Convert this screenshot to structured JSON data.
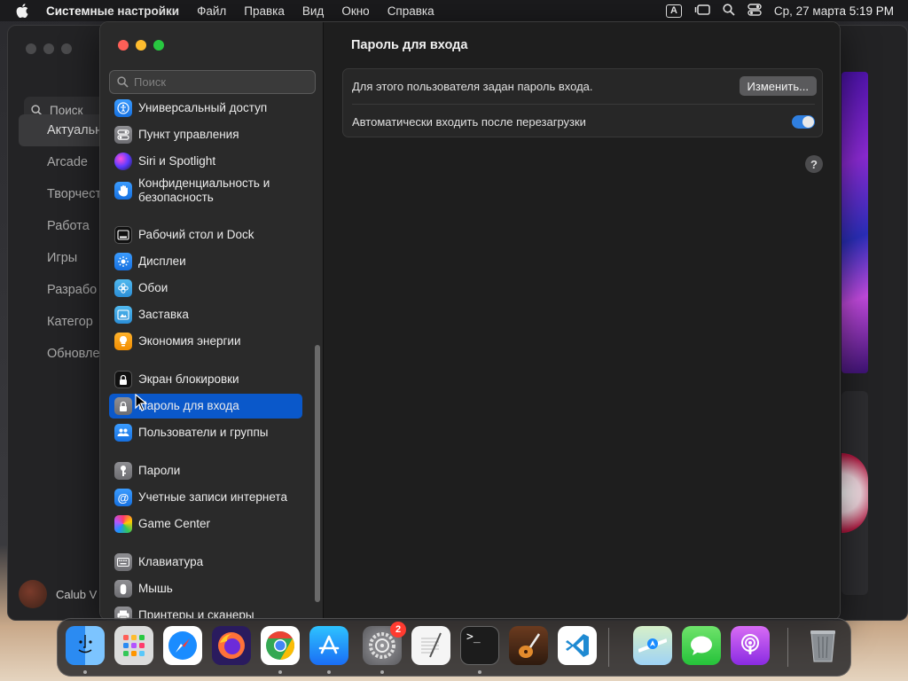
{
  "menubar": {
    "app_name": "Системные настройки",
    "items": [
      "Файл",
      "Правка",
      "Вид",
      "Окно",
      "Справка"
    ],
    "input_indicator": "A",
    "datetime": "Ср, 27 марта  5:19 PM"
  },
  "background_window": {
    "search_placeholder": "Поиск",
    "nav": [
      "Актуальн",
      "Arcade",
      "Творчест",
      "Работа",
      "Игры",
      "Разрабо",
      "Категор",
      "Обновле"
    ],
    "user": "Calub V"
  },
  "settings": {
    "search_placeholder": "Поиск",
    "sidebar_items": [
      {
        "label": "Универсальный доступ",
        "icon": "accessibility-icon"
      },
      {
        "label": "Пункт управления",
        "icon": "control-center-icon"
      },
      {
        "label": "Siri и Spotlight",
        "icon": "siri-icon"
      },
      {
        "label": "Конфиденциальность и безопасность",
        "icon": "privacy-hand-icon"
      },
      {
        "label": "Рабочий стол и Dock",
        "icon": "desktop-dock-icon"
      },
      {
        "label": "Дисплеи",
        "icon": "display-sun-icon"
      },
      {
        "label": "Обои",
        "icon": "wallpaper-flower-icon"
      },
      {
        "label": "Заставка",
        "icon": "screensaver-icon"
      },
      {
        "label": "Экономия энергии",
        "icon": "energy-bulb-icon"
      },
      {
        "label": "Экран блокировки",
        "icon": "lock-screen-icon"
      },
      {
        "label": "Пароль для входа",
        "icon": "login-password-lock-icon"
      },
      {
        "label": "Пользователи и группы",
        "icon": "users-groups-icon"
      },
      {
        "label": "Пароли",
        "icon": "passwords-key-icon"
      },
      {
        "label": "Учетные записи интернета",
        "icon": "internet-accounts-at-icon"
      },
      {
        "label": "Game Center",
        "icon": "game-center-icon"
      },
      {
        "label": "Клавиатура",
        "icon": "keyboard-icon"
      },
      {
        "label": "Мышь",
        "icon": "mouse-icon"
      },
      {
        "label": "Принтеры и сканеры",
        "icon": "printer-icon"
      }
    ],
    "selected_index": 10,
    "content": {
      "title": "Пароль для входа",
      "password_row": "Для этого пользователя задан пароль входа.",
      "change_button": "Изменить...",
      "autologin_row": "Автоматически входить после перезагрузки",
      "autologin_enabled": true,
      "help": "?"
    }
  },
  "dock": {
    "apps": [
      "Finder",
      "Launchpad",
      "Safari",
      "Firefox",
      "Chrome",
      "App Store",
      "Системные настройки",
      "TextEdit",
      "Terminal",
      "GarageBand",
      "VS Code",
      "Maps",
      "Messages",
      "Podcasts",
      "Trash"
    ],
    "settings_badge": "2"
  },
  "colors": {
    "accent": "#0a58ca",
    "toggle_on": "#2f7fe0",
    "badge": "#ff3b30"
  }
}
